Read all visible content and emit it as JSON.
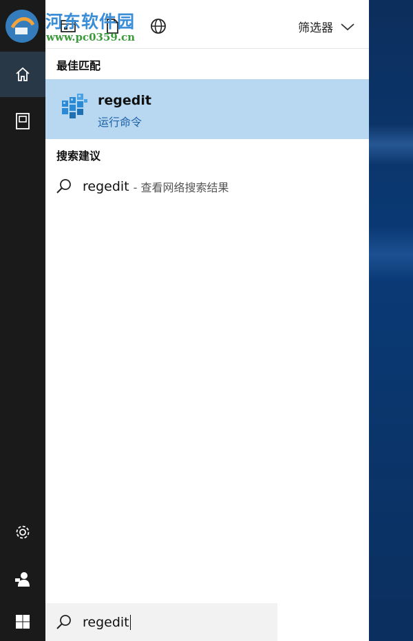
{
  "watermark": {
    "title": "河东软件园",
    "url": "www.pc0359.cn"
  },
  "topbar": {
    "filter_label": "筛选器"
  },
  "best_match": {
    "heading": "最佳匹配",
    "title": "regedit",
    "subtitle": "运行命令",
    "icon": "registry-editor-icon"
  },
  "suggestions": {
    "heading": "搜索建议",
    "items": [
      {
        "term": "regedit",
        "desc": "- 查看网络搜索结果"
      }
    ]
  },
  "search": {
    "value": "regedit"
  },
  "rail": {
    "items": [
      "hamburger-menu-icon",
      "home-icon",
      "documents-icon",
      "settings-icon",
      "user-icon",
      "windows-start-icon"
    ]
  },
  "colors": {
    "rail": "#1a1a1a",
    "highlight": "#b8d7f0",
    "accent_link": "#1d63a8"
  }
}
